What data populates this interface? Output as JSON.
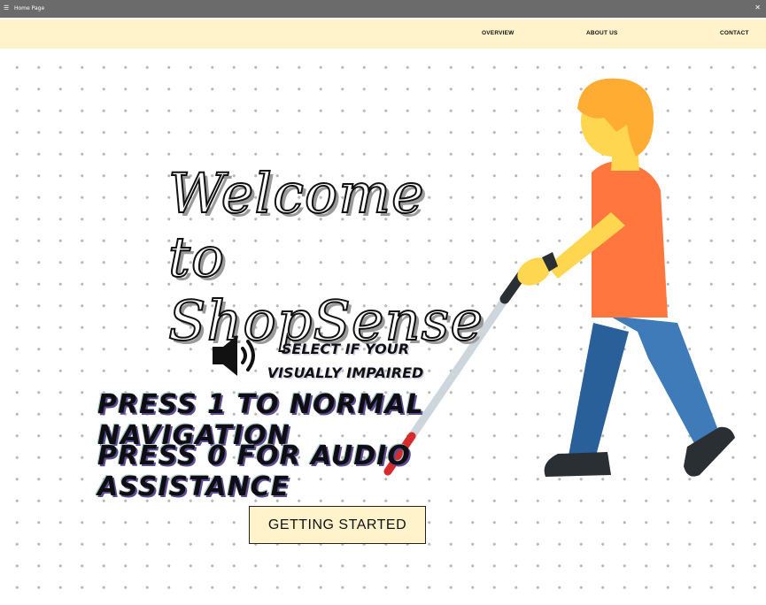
{
  "window": {
    "title": "Home Page"
  },
  "nav": {
    "overview": "OVERVIEW",
    "about": "ABOUT US",
    "contact": "CONTACT"
  },
  "hero": {
    "welcome_line1": "Welcome to",
    "welcome_line2": "ShopSense",
    "select_line1": "SELECT IF YOUR",
    "select_line2": "VISUALLY IMPAIRED",
    "press1": "PRESS 1 TO NORMAL NAVIGATION",
    "press0": "PRESS 0 FOR AUDIO ASSISTANCE",
    "cta": "GETTING STARTED"
  },
  "icons": {
    "speaker": "speaker-icon",
    "person": "person-with-white-cane-icon"
  },
  "colors": {
    "titlebar": "#6b6b6b",
    "navbar": "#fff3cc",
    "button": "#fff3cc",
    "shirt": "#ff773f",
    "skin": "#ffd64f",
    "hair": "#ffac33",
    "pants": "#3e7bb8"
  }
}
